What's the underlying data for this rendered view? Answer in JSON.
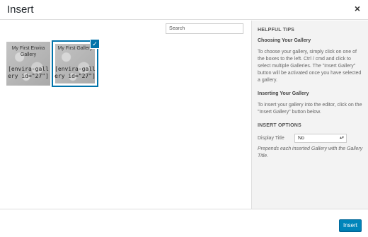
{
  "header": {
    "title": "Insert",
    "close_glyph": "×"
  },
  "main": {
    "search": {
      "placeholder": "Search",
      "value": ""
    },
    "galleries": [
      {
        "name": "My First Envira Gallery",
        "code": "[envira-gallery id=\"27\"]",
        "selected": false
      },
      {
        "name": "My First Gallery",
        "code": "[envira-gallery id=\"27\"]",
        "selected": true
      }
    ],
    "check_glyph": "✓"
  },
  "sidebar": {
    "help_heading": "HELPFUL TIPS",
    "choosing_title": "Choosing Your Gallery",
    "choosing_text": "To choose your gallery, simply click on one of the boxes to the left. Ctrl / cmd and click to select multiple Galleries. The \"Insert Gallery\" button will be activated once you have selected a gallery.",
    "inserting_title": "Inserting Your Gallery",
    "inserting_text": "To insert your gallery into the editor, click on the \"Insert Gallery\" button below.",
    "options_heading": "INSERT OPTIONS",
    "display_title_label": "Display Title",
    "display_title_value": "No",
    "display_title_desc": "Prepends each inserted Gallery with the Gallery Title."
  },
  "footer": {
    "insert_label": "Insert"
  },
  "colors": {
    "accent": "#0073aa",
    "button": "#0085ba",
    "sidebar_bg": "#f3f3f3"
  }
}
